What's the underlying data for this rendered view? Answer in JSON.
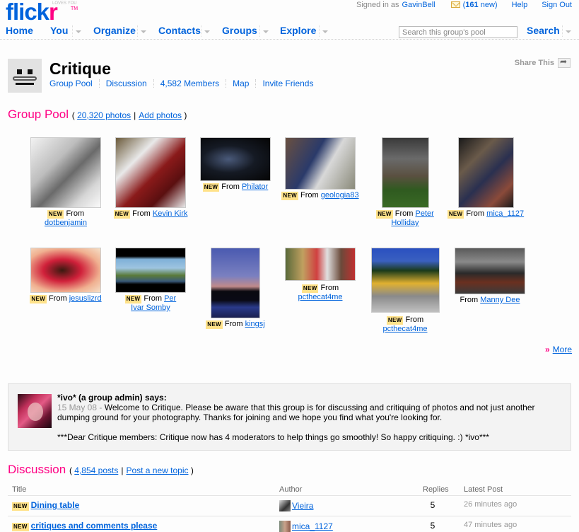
{
  "brand": {
    "logo_part1": "flick",
    "logo_part2": "r",
    "tagline": "LOVES YOU",
    "tm": "TM"
  },
  "topbar": {
    "signed_in_label": "Signed in as",
    "username": "GavinBell",
    "mail_icon": "envelope-icon",
    "mail_count": "161",
    "mail_suffix": " new)",
    "mail_prefix": "(",
    "help": "Help",
    "sign_out": "Sign Out"
  },
  "nav": {
    "items": [
      {
        "label": "Home",
        "dropdown": false
      },
      {
        "label": "You",
        "dropdown": true
      },
      {
        "label": "Organize",
        "dropdown": true
      },
      {
        "label": "Contacts",
        "dropdown": true
      },
      {
        "label": "Groups",
        "dropdown": true
      },
      {
        "label": "Explore",
        "dropdown": true
      }
    ],
    "search_placeholder": "Search this group's pool",
    "search_label": "Search"
  },
  "group": {
    "title": "Critique",
    "icon": "mustache-face-icon",
    "links": [
      "Group Pool",
      "Discussion",
      "4,582 Members",
      "Map",
      "Invite Friends"
    ],
    "share_label": "Share This",
    "share_icon": "share-arrow-icon"
  },
  "pool": {
    "heading": "Group Pool",
    "photo_count_link": "20,320 photos",
    "add_photos_link": "Add photos",
    "more_label": "More",
    "from_label": "From",
    "new_badge": "NEW",
    "photos": [
      {
        "author": "dotbenjamin",
        "new": true,
        "alt": "portrait of young man in hood with open mouth"
      },
      {
        "author": "Kevin Kirk",
        "new": true,
        "alt": "snow-covered rope sculpture"
      },
      {
        "author": "Philator",
        "new": true,
        "alt": "dark portrait of person resting head"
      },
      {
        "author": "geologia83",
        "new": true,
        "alt": "man holding paper and helmet on street"
      },
      {
        "author": "Peter Holliday",
        "new": true,
        "alt": "old stone house under stormy sky"
      },
      {
        "author": "mica_1127",
        "new": true,
        "alt": "man on phone hugging child"
      },
      {
        "author": "jesuslizrd",
        "new": true,
        "alt": "red hands holding dark fruit"
      },
      {
        "author": "Per Ivar Somby",
        "new": true,
        "alt": "panoramic landscape with lake"
      },
      {
        "author": "kingsj",
        "new": true,
        "alt": "twilight over lake with tree line"
      },
      {
        "author": "pcthecat4me",
        "new": true,
        "alt": "colorful village street scene"
      },
      {
        "author": "pcthecat4me",
        "new": true,
        "alt": "people in front of yellow building with tree"
      },
      {
        "author": "Manny Dee",
        "new": false,
        "alt": "marching band in uniforms"
      }
    ]
  },
  "notice": {
    "author": "*ivo* (a group admin) says:",
    "date": "15 May 08",
    "dash": " - ",
    "body1": "Welcome to Critique. Please be aware that this group is for discussing and critiquing of photos and not just another dumping ground for your photography. Thanks for joining and we hope you find what you're looking for.",
    "body2": "***Dear Critique members: Critique now has 4 moderators to help things go smoothly! So happy critiquing. :) *ivo***"
  },
  "discussion": {
    "heading": "Discussion",
    "posts_link": "4,854 posts",
    "new_topic_link": "Post a new topic",
    "columns": [
      "Title",
      "Author",
      "Replies",
      "Latest Post"
    ],
    "rows": [
      {
        "new": true,
        "title": "Dining table",
        "author": "Vieira",
        "replies": "5",
        "latest": "26 minutes ago"
      },
      {
        "new": true,
        "title": "critiques and comments please",
        "author": "mica_1127",
        "replies": "5",
        "latest": "47 minutes ago"
      }
    ]
  }
}
